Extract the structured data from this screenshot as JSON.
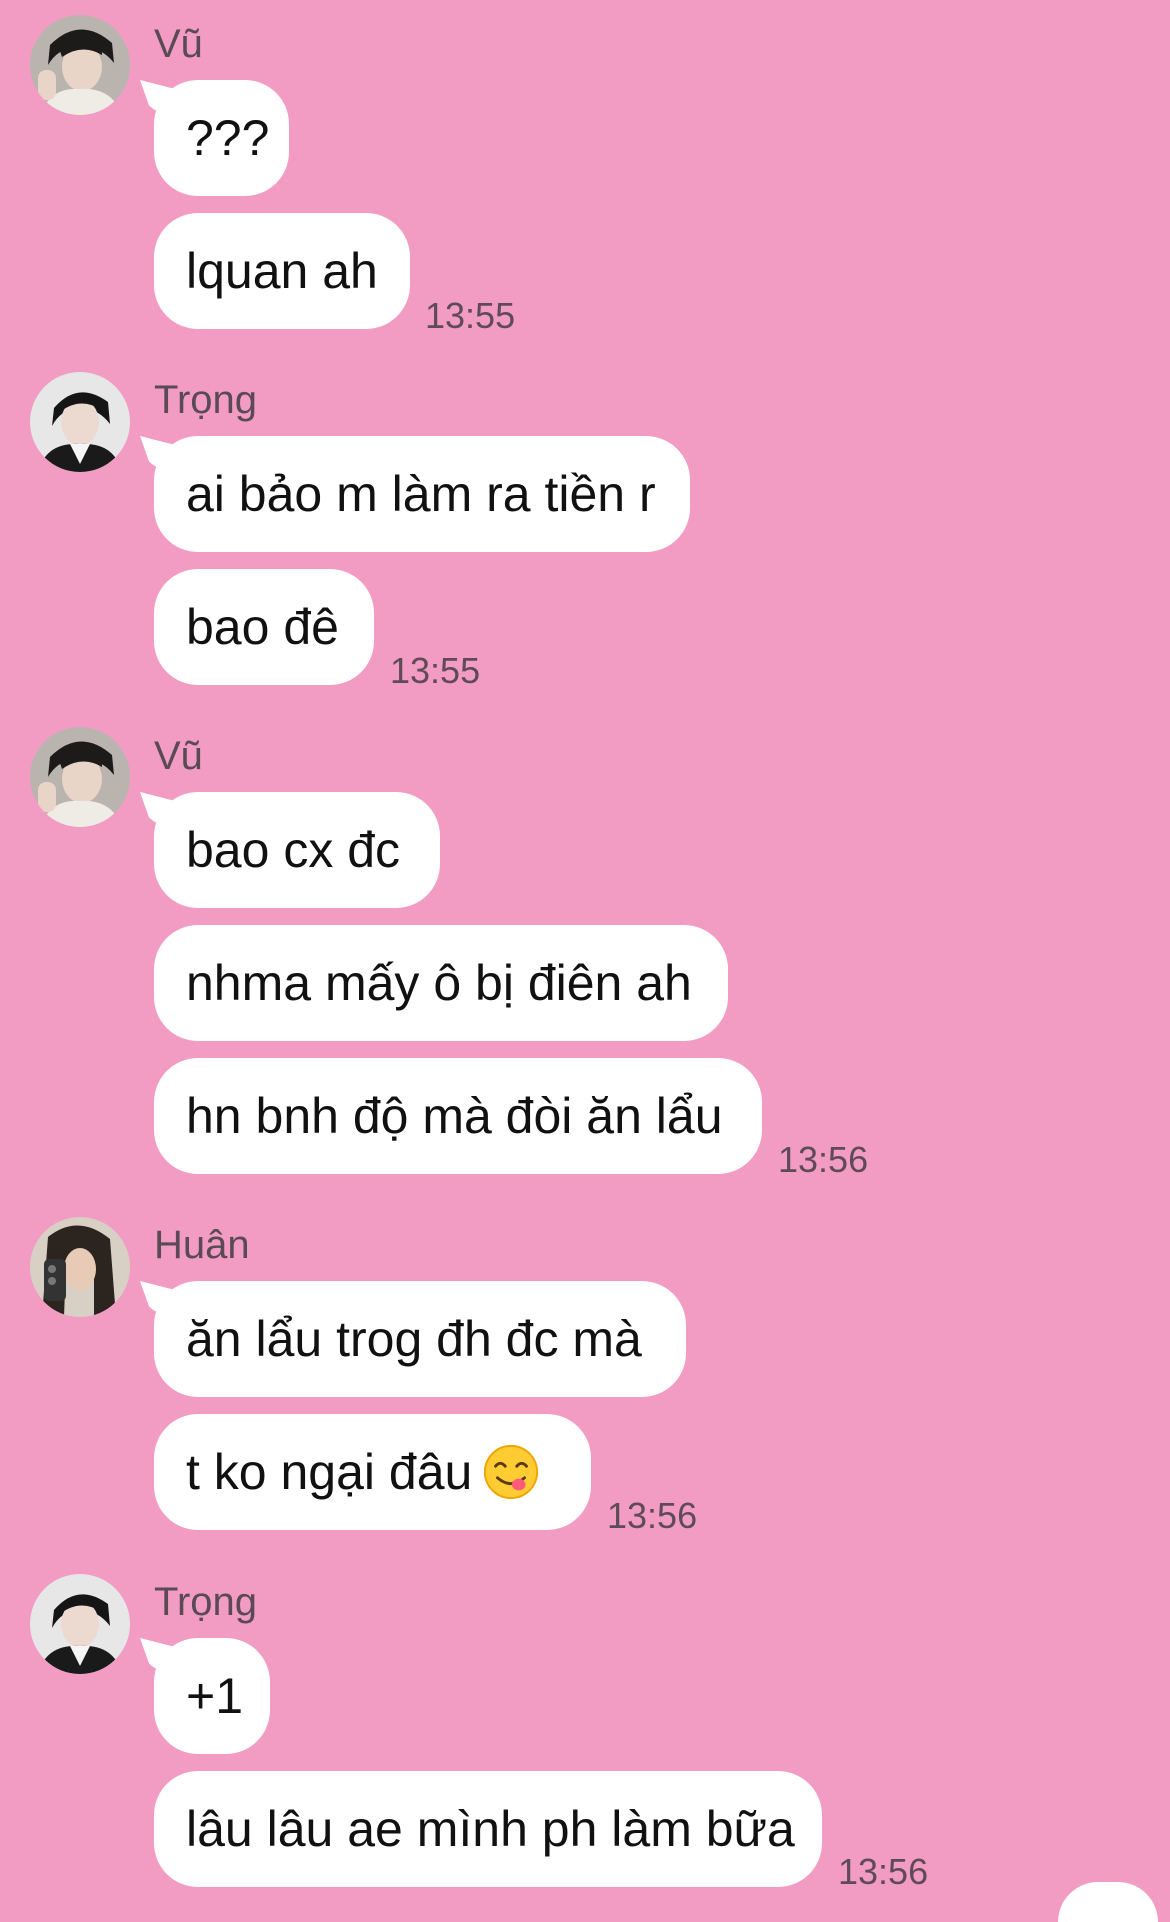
{
  "groups": [
    {
      "sender": "Vũ",
      "avatar_icon": "portrait-vu-icon",
      "messages": [
        "???",
        "lquan ah"
      ],
      "time": "13:55"
    },
    {
      "sender": "Trọng",
      "avatar_icon": "portrait-trong-icon",
      "messages": [
        "ai bảo m làm ra tiền r",
        "bao đê"
      ],
      "time": "13:55"
    },
    {
      "sender": "Vũ",
      "avatar_icon": "portrait-vu-icon",
      "messages": [
        "bao cx đc",
        "nhma mấy ô bị điên ah",
        "hn bnh độ mà đòi ăn lẩu"
      ],
      "time": "13:56"
    },
    {
      "sender": "Huân",
      "avatar_icon": "portrait-huan-icon",
      "messages": [
        "ăn lẩu trog đh đc mà",
        "t ko ngại đâu"
      ],
      "emoji": "😋",
      "time": "13:56"
    },
    {
      "sender": "Trọng",
      "avatar_icon": "portrait-trong-icon",
      "messages": [
        "+1",
        "lâu lâu ae mình ph làm bữa"
      ],
      "time": "13:56"
    }
  ],
  "colors": {
    "background": "#f29cc3",
    "bubble": "#ffffff",
    "text": "#111111",
    "meta": "#5f4b57"
  }
}
